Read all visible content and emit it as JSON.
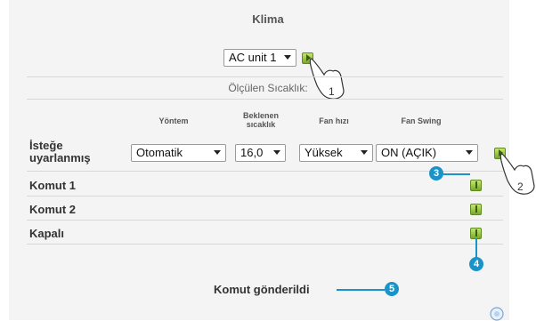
{
  "title": "Klima",
  "unit_select": {
    "value": "AC unit 1"
  },
  "measured_label": "Ölçülen Sıcaklık:",
  "columns": {
    "mode": "Yöntem",
    "setpoint_line1": "Beklenen",
    "setpoint_line2": "sıcaklık",
    "fan_speed": "Fan hızı",
    "fan_swing": "Fan Swing"
  },
  "custom_row": {
    "label_line1": "İsteğe",
    "label_line2": "uyarlanmış",
    "mode": "Otomatik",
    "setpoint": "16,0",
    "fan_speed": "Yüksek",
    "fan_swing": "ON (AÇIK)"
  },
  "commands": [
    {
      "label": "Komut 1"
    },
    {
      "label": "Komut 2"
    },
    {
      "label": "Kapalı"
    }
  ],
  "status_text": "Komut gönderildi",
  "callouts": {
    "c1": "1",
    "c2": "2",
    "c3": "3",
    "c4": "4",
    "c5": "5"
  },
  "colors": {
    "accent": "#1a93c9",
    "button_green": "#8bc34a",
    "panel": "#f4f4f4"
  },
  "icons": [
    "send-arrow-icon",
    "hand-cursor-icon",
    "info-icon"
  ]
}
